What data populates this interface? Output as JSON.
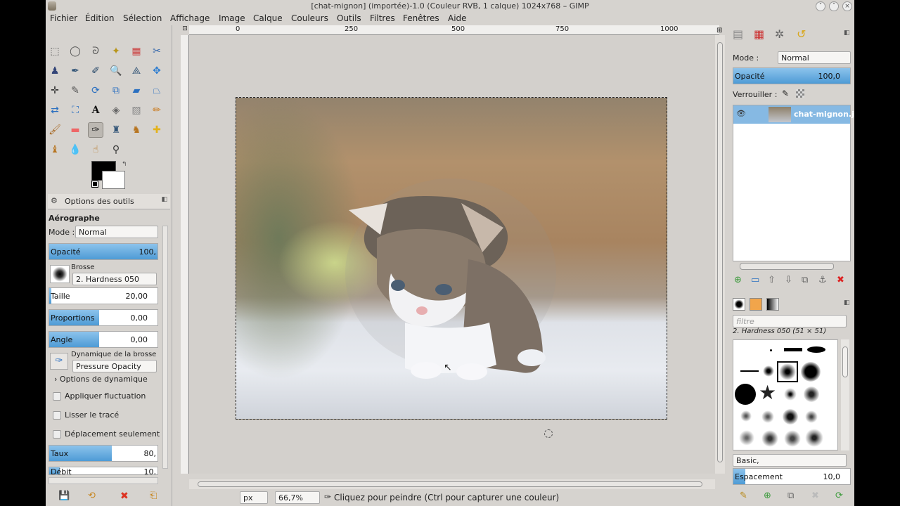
{
  "titlebar": {
    "title": "[chat-mignon] (importée)-1.0 (Couleur RVB, 1 calque) 1024x768 – GIMP"
  },
  "menu": [
    "Fichier",
    "Édition",
    "Sélection",
    "Affichage",
    "Image",
    "Calque",
    "Couleurs",
    "Outils",
    "Filtres",
    "Fenêtres",
    "Aide"
  ],
  "tool_options": {
    "tab": "Options des outils",
    "tool_name": "Aérographe",
    "mode_label": "Mode :",
    "mode_value": "Normal",
    "opacity_label": "Opacité",
    "opacity_value": "100,",
    "brush_label": "Brosse",
    "brush_value": "2. Hardness 050",
    "size_label": "Taille",
    "size_value": "20,00",
    "proportions_label": "Proportions",
    "proportions_value": "0,00",
    "angle_label": "Angle",
    "angle_value": "0,00",
    "dynamics_label": "Dynamique de la brosse",
    "dynamics_value": "Pressure Opacity",
    "dynamics_options": "Options de dynamique",
    "jitter": "Appliquer fluctuation",
    "smooth": "Lisser le tracé",
    "incremental": "Déplacement seulement",
    "rate_label": "Taux",
    "rate_value": "80,",
    "flow_label": "Débit",
    "flow_value": "10,"
  },
  "ruler": {
    "marks": [
      "0",
      "250",
      "500",
      "750",
      "1000"
    ]
  },
  "status": {
    "unit": "px",
    "zoom": "66,7%",
    "message": "Cliquez pour peindre (Ctrl pour capturer une couleur)"
  },
  "layers": {
    "mode_label": "Mode :",
    "mode_value": "Normal",
    "opacity_label": "Opacité",
    "opacity_value": "100,0",
    "lock_label": "Verrouiller :",
    "layer_name": "chat-mignon.j"
  },
  "brushes": {
    "filter_placeholder": "filtre",
    "selected": "2. Hardness 050 (51 × 51)",
    "tag": "Basic,",
    "spacing_label": "Espacement",
    "spacing_value": "10,0"
  }
}
